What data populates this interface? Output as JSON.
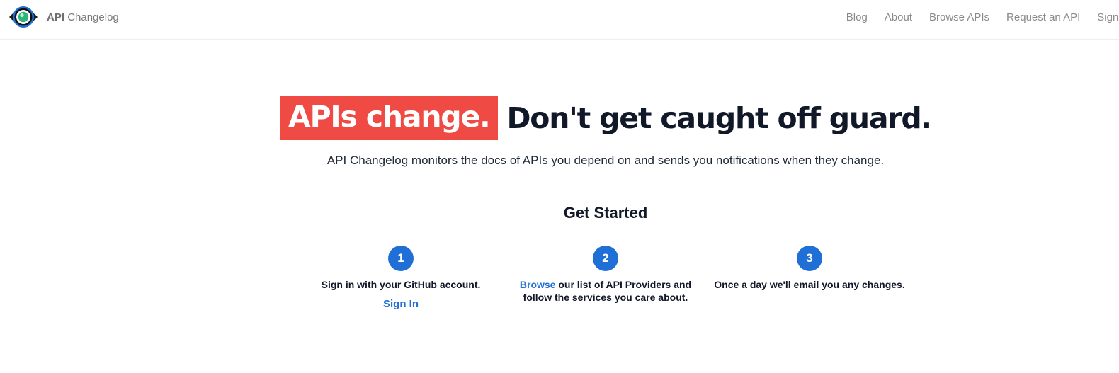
{
  "navbar": {
    "brand_strong": "API",
    "brand_rest": "Changelog",
    "links": [
      "Blog",
      "About",
      "Browse APIs",
      "Request an API",
      "Sign In"
    ]
  },
  "hero": {
    "highlight": "APIs change.",
    "rest": "Don't get caught off guard."
  },
  "tagline": "API Changelog monitors the docs of APIs you depend on and sends you notifications when they change.",
  "get_started": {
    "title": "Get Started",
    "steps": [
      {
        "number": "1",
        "text": "Sign in with your GitHub account.",
        "action": "Sign In"
      },
      {
        "number": "2",
        "link": "Browse",
        "text_after": " our list of API Providers and follow the services you care about."
      },
      {
        "number": "3",
        "text": "Once a day we'll email you any changes."
      }
    ]
  },
  "colors": {
    "accent": "#1f6fd6",
    "highlight": "#ef4a44",
    "text": "#111827",
    "nav_text": "#8a8a8a"
  },
  "icons": {
    "logo": "eye-icon"
  }
}
